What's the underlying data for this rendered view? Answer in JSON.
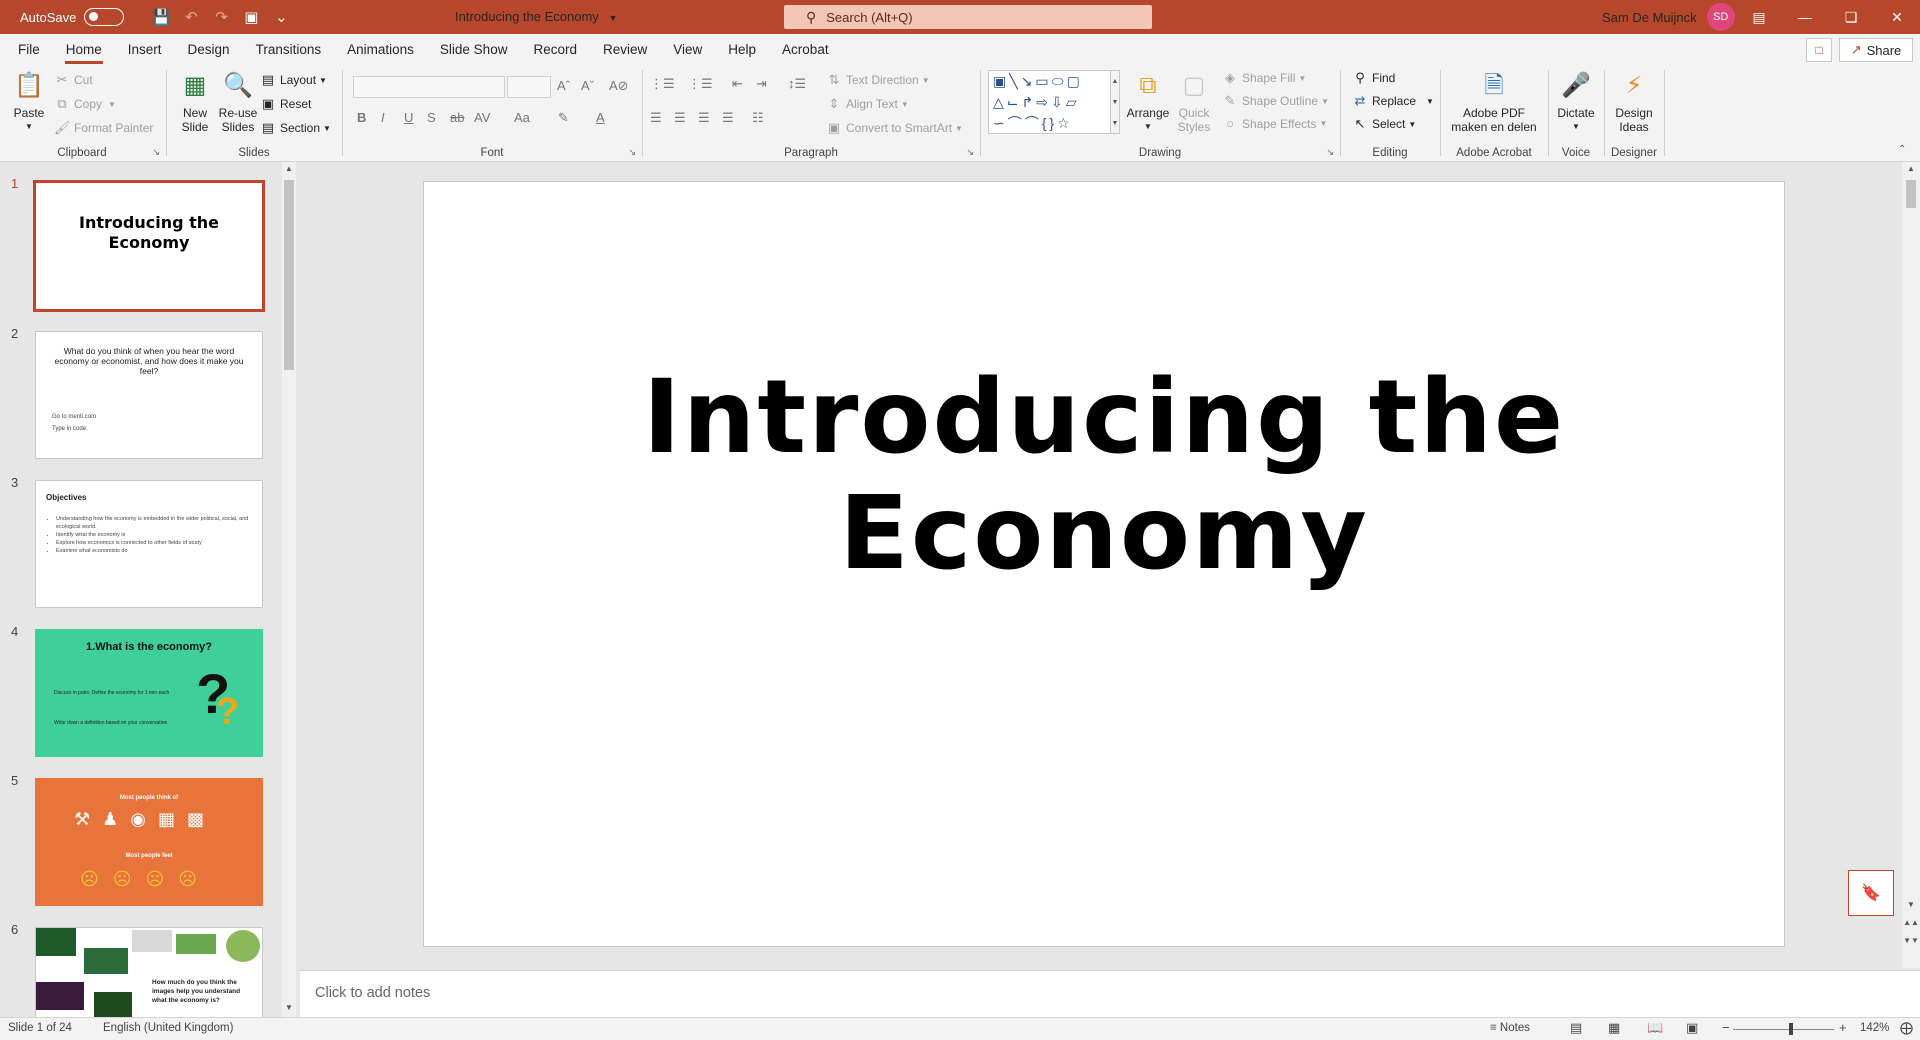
{
  "titlebar": {
    "autosave_label": "AutoSave",
    "autosave_state": "Off",
    "doc_title": "Introducing the Economy",
    "search_placeholder": "Search (Alt+Q)",
    "user_name": "Sam De Muijnck",
    "user_initials": "SD",
    "brand_color": "#b7472a"
  },
  "tabs": [
    "File",
    "Home",
    "Insert",
    "Design",
    "Transitions",
    "Animations",
    "Slide Show",
    "Record",
    "Review",
    "View",
    "Help",
    "Acrobat"
  ],
  "active_tab": "Home",
  "share_label": "Share",
  "ribbon": {
    "clipboard": {
      "label": "Clipboard",
      "paste": "Paste",
      "cut": "Cut",
      "copy": "Copy",
      "format_painter": "Format Painter"
    },
    "slides": {
      "label": "Slides",
      "new_slide": "New Slide",
      "reuse_slides": "Re-use Slides",
      "layout": "Layout",
      "reset": "Reset",
      "section": "Section"
    },
    "font": {
      "label": "Font"
    },
    "paragraph": {
      "label": "Paragraph",
      "text_direction": "Text Direction",
      "align_text": "Align Text",
      "convert_smartart": "Convert to SmartArt"
    },
    "drawing": {
      "label": "Drawing",
      "arrange": "Arrange",
      "quick_styles": "Quick Styles",
      "shape_fill": "Shape Fill",
      "shape_outline": "Shape Outline",
      "shape_effects": "Shape Effects"
    },
    "editing": {
      "label": "Editing",
      "find": "Find",
      "replace": "Replace",
      "select": "Select"
    },
    "acrobat": {
      "label": "Adobe Acrobat",
      "button": "Adobe PDF maken en delen"
    },
    "voice": {
      "label": "Voice",
      "dictate": "Dictate"
    },
    "designer": {
      "label": "Designer",
      "design_ideas": "Design Ideas"
    }
  },
  "slides": [
    {
      "num": "1",
      "title": "Introducing the Economy"
    },
    {
      "num": "2",
      "text": "What do you think of when you hear the word economy or economist, and how does it make you feel?",
      "line1": "Go to menti.com",
      "line2": "Type in code:"
    },
    {
      "num": "3",
      "title": "Objectives",
      "bullets": [
        "Understanding how the economy is embedded in the wider political, social, and ecological world.",
        "Identify what the economy is",
        "Explore how economics is connected to other fields of study",
        "Examine what economists do"
      ]
    },
    {
      "num": "4",
      "title": "1.What is the economy?",
      "line1": "Discuss in pairs: Define the economy for 1 min each",
      "line2": "Write down a definition based on your conversation",
      "bg": "#3ecf9a"
    },
    {
      "num": "5",
      "title": "Most people think of",
      "subtitle": "Most people feel",
      "bg": "#e8743b"
    },
    {
      "num": "6",
      "text": "How much do you think the images help you understand what the economy is?"
    }
  ],
  "current_slide": {
    "title": "Introducing the Economy"
  },
  "notes_placeholder": "Click to add notes",
  "status": {
    "slide_of": "Slide 1 of 24",
    "language": "English (United Kingdom)",
    "notes": "Notes",
    "zoom": "142%"
  }
}
